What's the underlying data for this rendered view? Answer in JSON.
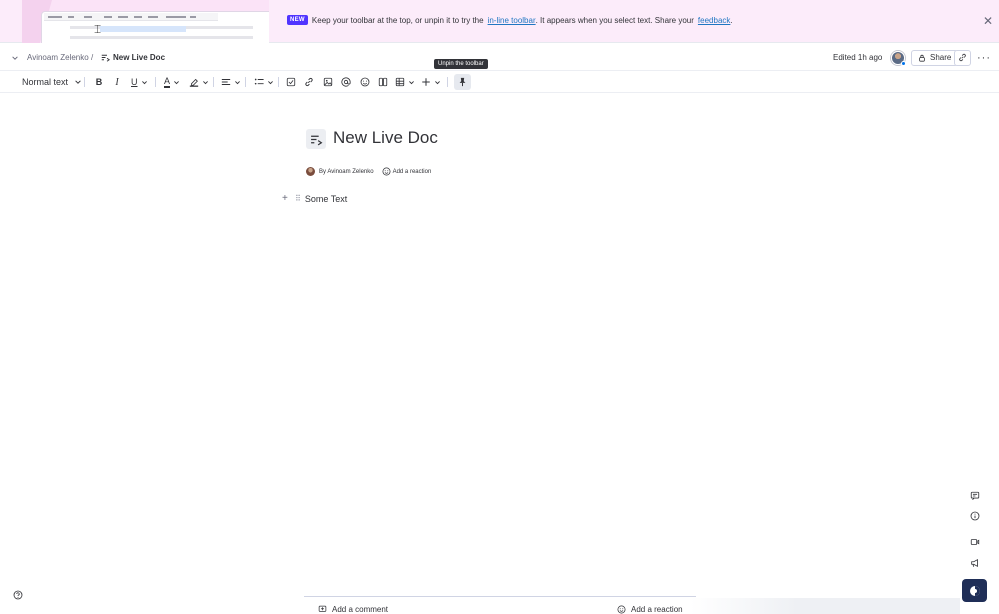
{
  "banner": {
    "badge": "NEW",
    "text_1": "Keep your toolbar at the top, or unpin it to try the",
    "link_inline": "in-line toolbar",
    "text_2": ". It appears when you select text. Share your",
    "link_feedback": "feedback",
    "text_3": ".",
    "close_icon": "close-icon"
  },
  "header": {
    "workspace": "Avinoam Zelenko",
    "separator": "/",
    "doc_name": "New Live Doc",
    "edited": "Edited 1h ago",
    "share_label": "Share"
  },
  "tooltip": "Unpin the toolbar",
  "toolbar": {
    "text_style": "Normal text",
    "bold": "B",
    "italic": "I",
    "underline": "U",
    "text_color": "A"
  },
  "document": {
    "title": "New Live Doc",
    "author": "By Avinoam Zelenko",
    "add_reaction": "Add a reaction",
    "block_text": "Some Text"
  },
  "footer": {
    "add_comment": "Add a comment",
    "add_reaction": "Add a reaction"
  },
  "colors": {
    "banner_bg": "#fcecfa",
    "badge": "#5034ff",
    "link": "#1f76c2",
    "fab": "#1f2e57",
    "text": "#323338"
  }
}
